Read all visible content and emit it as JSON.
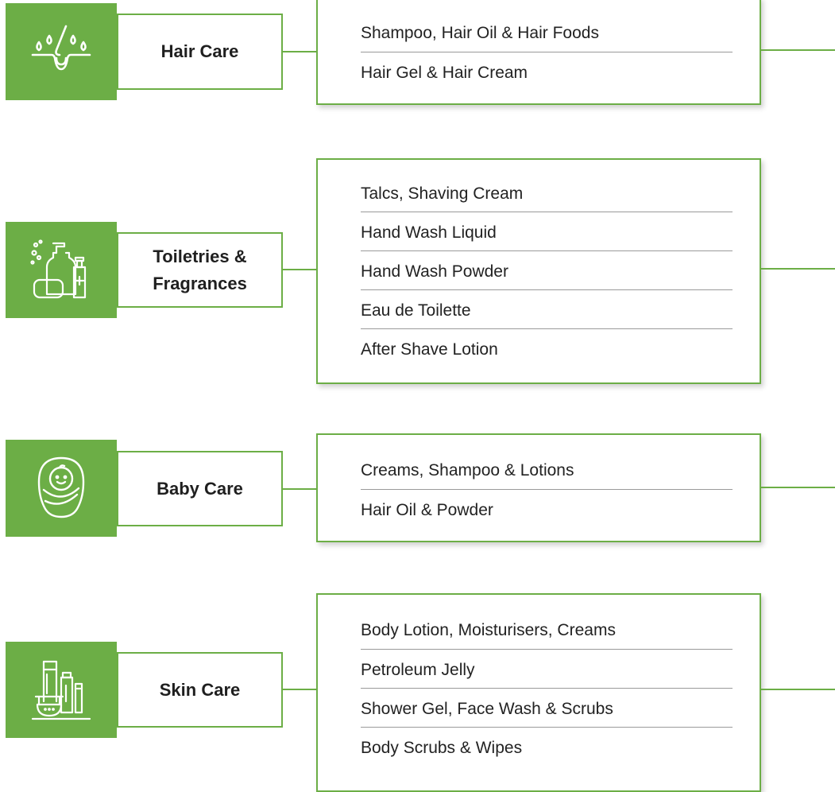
{
  "accent_color": "#6cae46",
  "categories": [
    {
      "name": "Hair Care",
      "icon": "hair-follicle-droplets-icon",
      "items": [
        "Shampoo, Hair Oil & Hair Foods",
        "Hair Gel & Hair Cream"
      ]
    },
    {
      "name": "Toiletries &\nFragrances",
      "icon": "toiletries-bottles-soap-icon",
      "items": [
        "Talcs, Shaving Cream",
        "Hand Wash Liquid",
        "Hand Wash Powder",
        "Eau de Toilette",
        "After Shave Lotion"
      ]
    },
    {
      "name": "Baby Care",
      "icon": "swaddled-baby-icon",
      "items": [
        "Creams, Shampoo & Lotions",
        "Hair Oil & Powder"
      ]
    },
    {
      "name": "Skin Care",
      "icon": "skincare-jars-tubes-icon",
      "items": [
        "Body Lotion, Moisturisers, Creams",
        "Petroleum Jelly",
        "Shower Gel, Face Wash & Scrubs",
        "Body Scrubs & Wipes"
      ]
    }
  ]
}
